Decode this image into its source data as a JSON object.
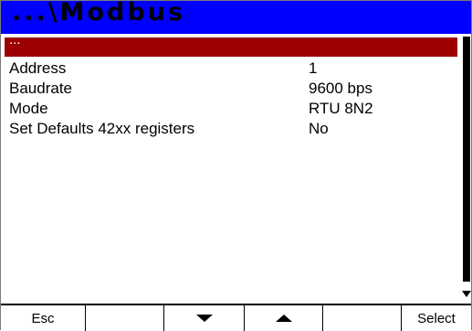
{
  "title": "...\\Modbus",
  "menu": {
    "items": [
      {
        "label": "...",
        "value": ""
      },
      {
        "label": "Address",
        "value": "1"
      },
      {
        "label": "Baudrate",
        "value": "9600 bps"
      },
      {
        "label": "Mode",
        "value": "RTU 8N2"
      },
      {
        "label": "Set Defaults 42xx registers",
        "value": "No"
      }
    ],
    "selected_index": 0
  },
  "softkeys": {
    "esc": "Esc",
    "down_icon": "down-triangle",
    "up_icon": "up-triangle",
    "select": "Select"
  },
  "colors": {
    "title_bar": "#0000ff",
    "selection": "#9c0000",
    "background": "#ffffff"
  }
}
